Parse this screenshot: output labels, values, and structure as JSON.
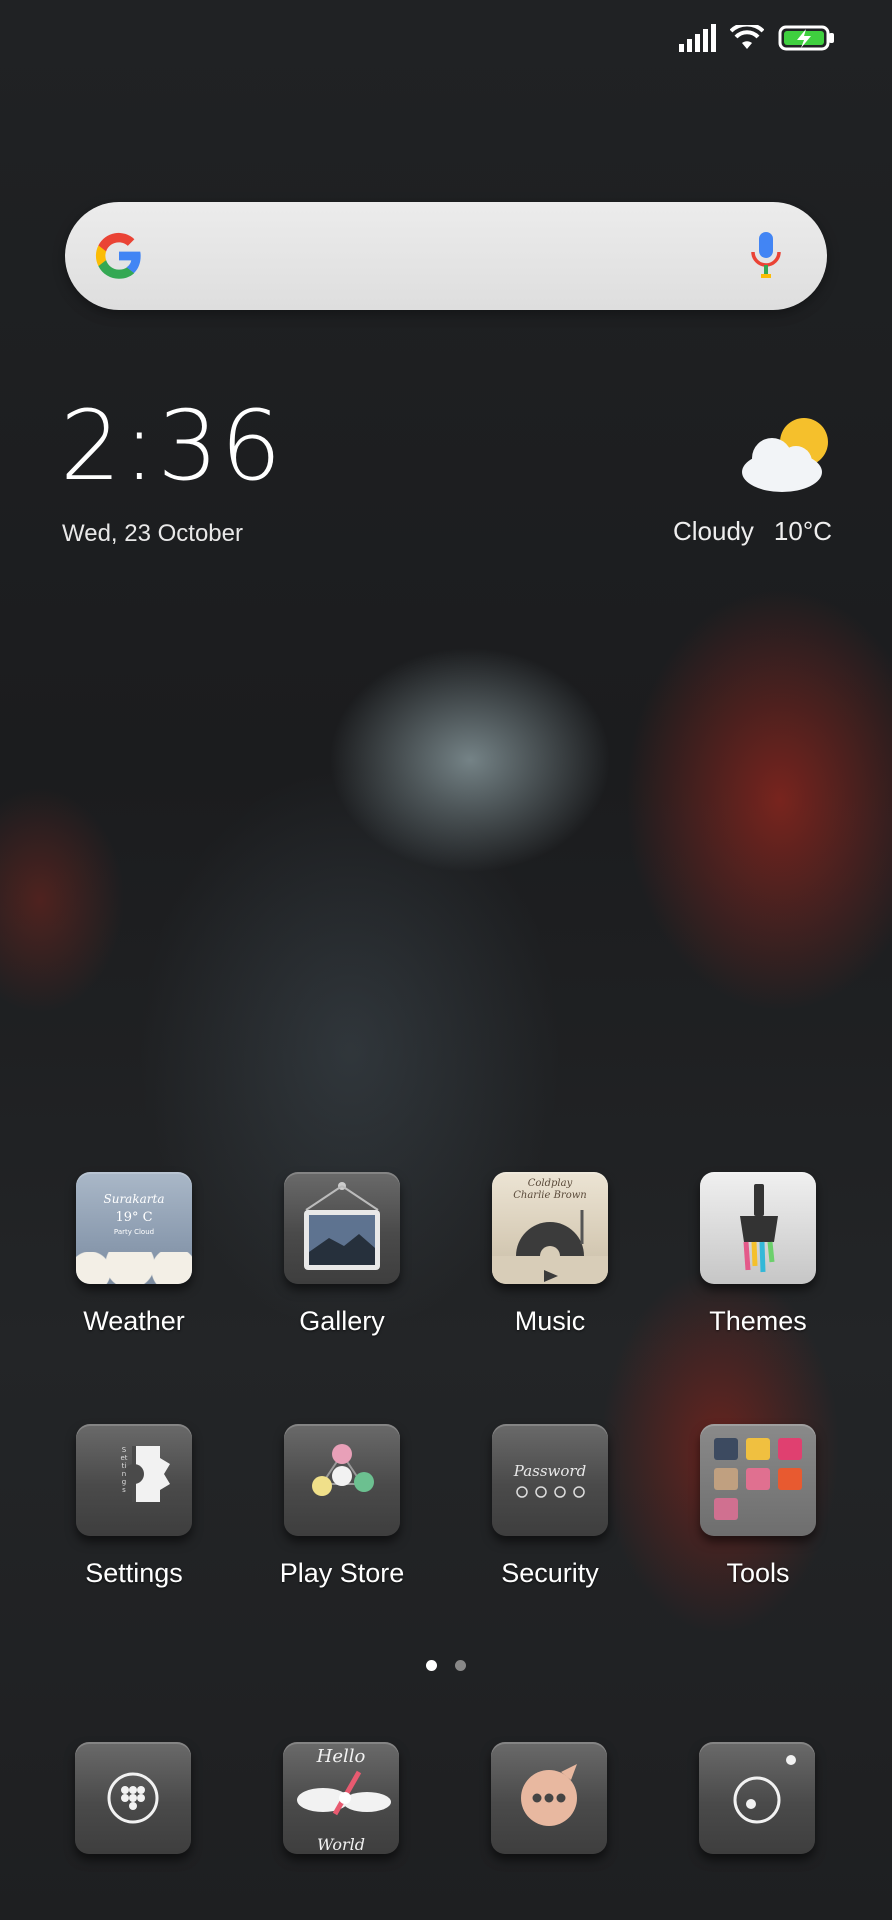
{
  "status_bar": {
    "signal": "signal-icon",
    "wifi": "wifi-icon",
    "battery": "battery-charging-icon"
  },
  "search": {
    "logo": "google-logo-icon",
    "mic": "mic-icon"
  },
  "clock": {
    "time": "2:36",
    "date": "Wed, 23 October"
  },
  "weather": {
    "condition": "Cloudy",
    "temperature": "10°C",
    "icon": "partly-cloudy-icon"
  },
  "apps": [
    {
      "label": "Weather"
    },
    {
      "label": "Gallery"
    },
    {
      "label": "Music"
    },
    {
      "label": "Themes"
    },
    {
      "label": "Settings"
    },
    {
      "label": "Play Store"
    },
    {
      "label": "Security"
    },
    {
      "label": "Tools"
    }
  ],
  "icon_text": {
    "weather_city": "Surakarta",
    "weather_temp": "19° C",
    "weather_desc": "Party Cloud",
    "music_line1": "Coldplay",
    "music_line2": "Charlie Brown",
    "security_text": "Password",
    "settings_text": "Settings",
    "hello": "Hello",
    "world": "World"
  },
  "pages": {
    "total": 2,
    "current": 1
  },
  "dock": [
    {
      "icon": "phone-dialer-icon"
    },
    {
      "icon": "browser-icon"
    },
    {
      "icon": "messages-icon"
    },
    {
      "icon": "camera-icon"
    }
  ]
}
